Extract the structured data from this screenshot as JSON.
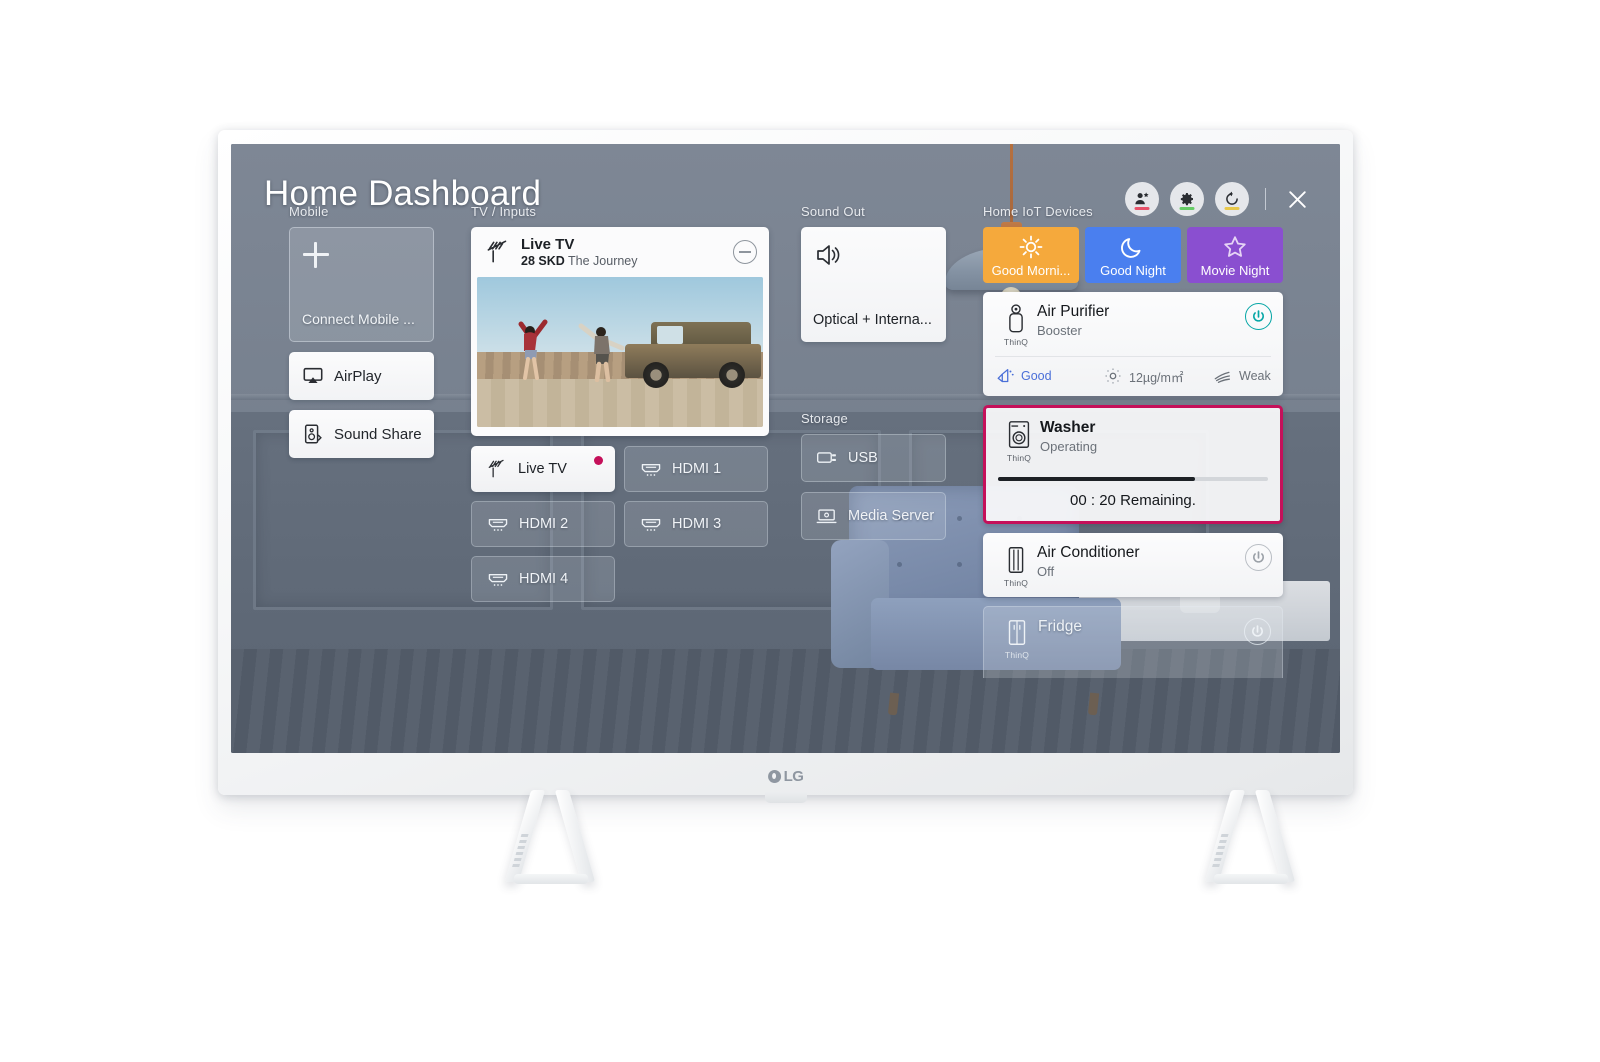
{
  "tv": {
    "brand_logo": "LG"
  },
  "header": {
    "title": "Home Dashboard",
    "buttons": [
      {
        "name": "account-button",
        "icon": "user-star-icon",
        "accent": "#e8526a"
      },
      {
        "name": "settings-button",
        "icon": "gear-icon",
        "accent": "#66cc66"
      },
      {
        "name": "refresh-button",
        "icon": "refresh-icon",
        "accent": "#e8c84a"
      }
    ],
    "close_label": "✕"
  },
  "mobile": {
    "section_label": "Mobile",
    "connect_label": "Connect Mobile ...",
    "rows": [
      {
        "label": "AirPlay",
        "icon": "airplay-icon"
      },
      {
        "label": "Sound Share",
        "icon": "sound-share-icon"
      }
    ]
  },
  "tv_inputs": {
    "section_label": "TV / Inputs",
    "current": {
      "icon": "antenna-icon",
      "title": "Live TV",
      "channel": "28 SKD",
      "program": "The Journey",
      "minus_label": "−"
    },
    "buttons": [
      {
        "label": "Live TV",
        "icon": "antenna-icon",
        "active": true,
        "indicator": true
      },
      {
        "label": "HDMI 1",
        "icon": "hdmi-icon",
        "active": false,
        "indicator": false
      },
      {
        "label": "HDMI 2",
        "icon": "hdmi-icon",
        "active": false,
        "indicator": false
      },
      {
        "label": "HDMI 3",
        "icon": "hdmi-icon",
        "active": false,
        "indicator": false
      },
      {
        "label": "HDMI 4",
        "icon": "hdmi-icon",
        "active": false,
        "indicator": false
      }
    ]
  },
  "sound_out": {
    "section_label": "Sound Out",
    "icon": "speaker-icon",
    "value": "Optical + Interna..."
  },
  "storage": {
    "section_label": "Storage",
    "rows": [
      {
        "label": "USB",
        "icon": "usb-icon"
      },
      {
        "label": "Media Server",
        "icon": "media-server-icon"
      }
    ]
  },
  "home_iot": {
    "section_label": "Home IoT Devices",
    "scenes": [
      {
        "label": "Good Morni...",
        "icon": "sun-icon",
        "color": "#f5a93c"
      },
      {
        "label": "Good Night",
        "icon": "moon-icon",
        "color": "#4a7fef"
      },
      {
        "label": "Movie Night",
        "icon": "star-icon",
        "color": "#8a4fd0"
      }
    ],
    "devices": [
      {
        "name": "Air Purifier",
        "status": "Booster",
        "brand": "ThinQ",
        "icon": "air-purifier-icon",
        "power": "on",
        "power_color": "#06a6a6",
        "metrics": [
          {
            "label": "Good",
            "icon": "air-quality-icon",
            "highlight": true
          },
          {
            "label": "12µg/m㎡",
            "icon": "dust-icon",
            "highlight": false
          },
          {
            "label": "Weak",
            "icon": "wind-icon",
            "highlight": false
          }
        ]
      },
      {
        "name": "Washer",
        "status": "Operating",
        "brand": "ThinQ",
        "icon": "washer-icon",
        "focused": true,
        "focus_color": "#c5105a",
        "progress_percent": 73,
        "remaining": "00 : 20 Remaining."
      },
      {
        "name": "Air Conditioner",
        "status": "Off",
        "brand": "ThinQ",
        "icon": "air-conditioner-icon",
        "power": "off"
      },
      {
        "name": "Fridge",
        "status": "",
        "brand": "ThinQ",
        "icon": "fridge-icon",
        "dimmed": true
      }
    ]
  }
}
